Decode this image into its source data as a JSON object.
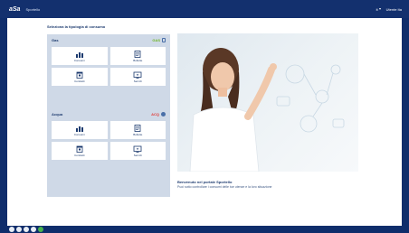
{
  "topbar": {
    "logo": "aSa",
    "subtitle": "Sportello",
    "language": "it",
    "user_label": "Utente Ita"
  },
  "page": {
    "title": "Seleziona la tipologia di consumo"
  },
  "gas_panel": {
    "title": "Gas",
    "badge": "GAS",
    "tiles": [
      {
        "label": "Consumi",
        "icon": "bar-chart-icon"
      },
      {
        "label": "Bollette",
        "icon": "invoice-icon"
      },
      {
        "label": "Contratti",
        "icon": "calendar-icon"
      },
      {
        "label": "Servizi",
        "icon": "tv-icon"
      }
    ]
  },
  "water_panel": {
    "title": "Acqua",
    "badge": "ACQ",
    "tiles": [
      {
        "label": "Consumi",
        "icon": "bar-chart-icon"
      },
      {
        "label": "Bollette",
        "icon": "invoice-icon"
      },
      {
        "label": "Contratti",
        "icon": "calendar-icon"
      },
      {
        "label": "Servizi",
        "icon": "tv-icon"
      }
    ]
  },
  "hero": {
    "title": "Benvenuto nel portale Sportello",
    "text": "Puoi sotto controllare i consumi delle tue utenze e la loro situazione"
  },
  "colors": {
    "navy": "#13306e",
    "panel": "#cfd9e7",
    "gas_accent": "#6fb526",
    "water_accent": "#e23a36"
  }
}
